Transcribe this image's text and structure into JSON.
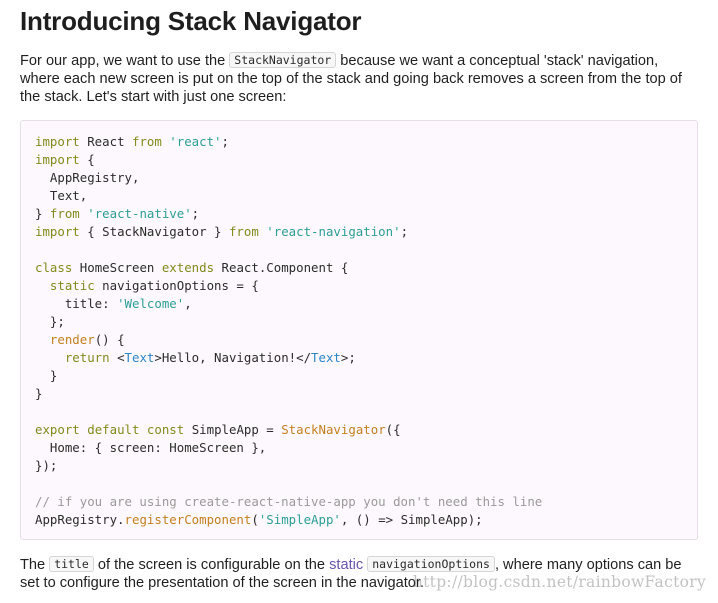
{
  "heading": "Introducing Stack Navigator",
  "intro": {
    "before": "For our app, we want to use the ",
    "code": "StackNavigator",
    "after": " because we want a conceptual 'stack' navigation, where each new screen is put on the top of the stack and going back removes a screen from the top of the stack. Let's start with just one screen:"
  },
  "code_lines": [
    [
      {
        "t": "import",
        "c": "kw"
      },
      {
        "t": " React ",
        "c": "plain"
      },
      {
        "t": "from",
        "c": "kw"
      },
      {
        "t": " ",
        "c": "plain"
      },
      {
        "t": "'react'",
        "c": "str"
      },
      {
        "t": ";",
        "c": "plain"
      }
    ],
    [
      {
        "t": "import",
        "c": "kw"
      },
      {
        "t": " {",
        "c": "plain"
      }
    ],
    [
      {
        "t": "  AppRegistry,",
        "c": "plain"
      }
    ],
    [
      {
        "t": "  Text,",
        "c": "plain"
      }
    ],
    [
      {
        "t": "} ",
        "c": "plain"
      },
      {
        "t": "from",
        "c": "kw"
      },
      {
        "t": " ",
        "c": "plain"
      },
      {
        "t": "'react-native'",
        "c": "str"
      },
      {
        "t": ";",
        "c": "plain"
      }
    ],
    [
      {
        "t": "import",
        "c": "kw"
      },
      {
        "t": " { StackNavigator } ",
        "c": "plain"
      },
      {
        "t": "from",
        "c": "kw"
      },
      {
        "t": " ",
        "c": "plain"
      },
      {
        "t": "'react-navigation'",
        "c": "str"
      },
      {
        "t": ";",
        "c": "plain"
      }
    ],
    [],
    [
      {
        "t": "class",
        "c": "kw"
      },
      {
        "t": " HomeScreen ",
        "c": "plain"
      },
      {
        "t": "extends",
        "c": "kw"
      },
      {
        "t": " React.Component {",
        "c": "plain"
      }
    ],
    [
      {
        "t": "  ",
        "c": "plain"
      },
      {
        "t": "static",
        "c": "kw"
      },
      {
        "t": " navigationOptions = {",
        "c": "plain"
      }
    ],
    [
      {
        "t": "    title: ",
        "c": "plain"
      },
      {
        "t": "'Welcome'",
        "c": "str"
      },
      {
        "t": ",",
        "c": "plain"
      }
    ],
    [
      {
        "t": "  };",
        "c": "plain"
      }
    ],
    [
      {
        "t": "  ",
        "c": "plain"
      },
      {
        "t": "render",
        "c": "fn"
      },
      {
        "t": "() {",
        "c": "plain"
      }
    ],
    [
      {
        "t": "    ",
        "c": "plain"
      },
      {
        "t": "return",
        "c": "kw"
      },
      {
        "t": " <",
        "c": "plain"
      },
      {
        "t": "Text",
        "c": "tag"
      },
      {
        "t": ">Hello, Navigation!</",
        "c": "plain"
      },
      {
        "t": "Text",
        "c": "tag"
      },
      {
        "t": ">;",
        "c": "plain"
      }
    ],
    [
      {
        "t": "  }",
        "c": "plain"
      }
    ],
    [
      {
        "t": "}",
        "c": "plain"
      }
    ],
    [],
    [
      {
        "t": "export",
        "c": "kw"
      },
      {
        "t": " ",
        "c": "plain"
      },
      {
        "t": "default",
        "c": "kw"
      },
      {
        "t": " ",
        "c": "plain"
      },
      {
        "t": "const",
        "c": "kw"
      },
      {
        "t": " SimpleApp = ",
        "c": "plain"
      },
      {
        "t": "StackNavigator",
        "c": "fn"
      },
      {
        "t": "({",
        "c": "plain"
      }
    ],
    [
      {
        "t": "  Home: { screen: HomeScreen },",
        "c": "plain"
      }
    ],
    [
      {
        "t": "});",
        "c": "plain"
      }
    ],
    [],
    [
      {
        "t": "// if you are using create-react-native-app you don't need this line",
        "c": "com"
      }
    ],
    [
      {
        "t": "AppRegistry.",
        "c": "plain"
      },
      {
        "t": "registerComponent",
        "c": "fn"
      },
      {
        "t": "(",
        "c": "plain"
      },
      {
        "t": "'SimpleApp'",
        "c": "str"
      },
      {
        "t": ", () => SimpleApp);",
        "c": "plain"
      }
    ]
  ],
  "outro": {
    "the": "The ",
    "code1": "title",
    "mid": " of the screen is configurable on the ",
    "static_link": "static",
    "space": " ",
    "code2": "navigationOptions",
    "after": ", where many options can be set to configure the presentation of the screen in the navigator."
  },
  "watermark": "http://blog.csdn.net/rainbowFactory",
  "colors": {
    "keyword": "#808b1c",
    "string": "#2c9e96",
    "function": "#c37f1f",
    "tag": "#2d85c9",
    "comment": "#9a9a9a",
    "link": "#6b52ae"
  }
}
